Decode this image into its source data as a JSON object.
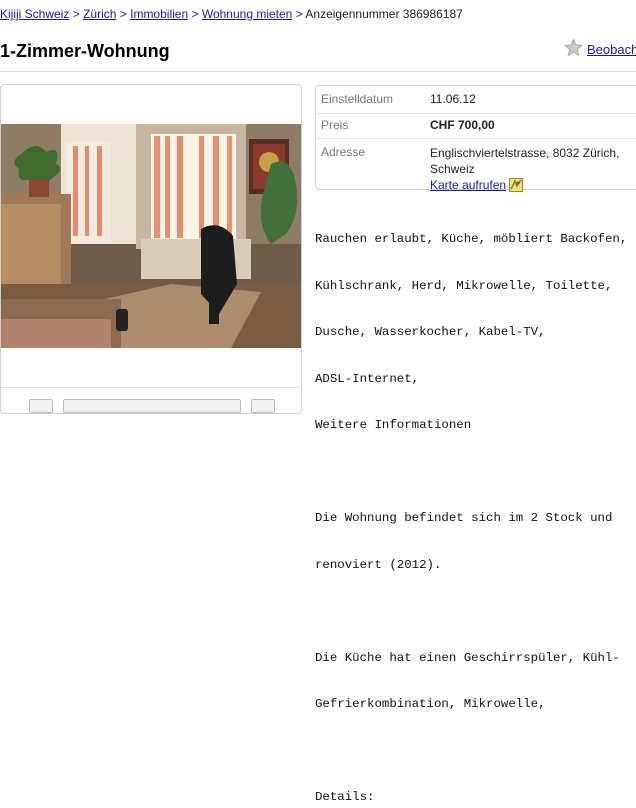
{
  "breadcrumb": {
    "items": [
      "Kijiji Schweiz",
      "Zürich",
      "Immobilien",
      "Wohnung mieten"
    ],
    "current": "Anzeigennummer 386986187"
  },
  "title": "1-Zimmer-Wohnung",
  "watch_label": "Beobachten",
  "info": {
    "date_label": "Einstelldatum",
    "date_value": "11.06.12",
    "price_label": "Preis",
    "price_value": "CHF 700,00",
    "address_label": "Adresse",
    "address_line1": "Englischviertelstrasse, 8032 Zürich,",
    "address_line2": "Schweiz",
    "map_link": "Karte aufrufen"
  },
  "description": [
    "Rauchen erlaubt, Küche, möbliert Backofen,",
    "Kühlschrank, Herd, Mikrowelle, Toilette,",
    "Dusche, Wasserkocher, Kabel-TV,",
    "ADSL-Internet,",
    "Weitere Informationen",
    "",
    "Die Wohnung befindet sich im 2 Stock und",
    "renoviert (2012).",
    "",
    "Die Küche hat einen Geschirrspüler, Kühl-",
    "Gefrierkombination, Mikrowelle,",
    "",
    "Details:"
  ]
}
